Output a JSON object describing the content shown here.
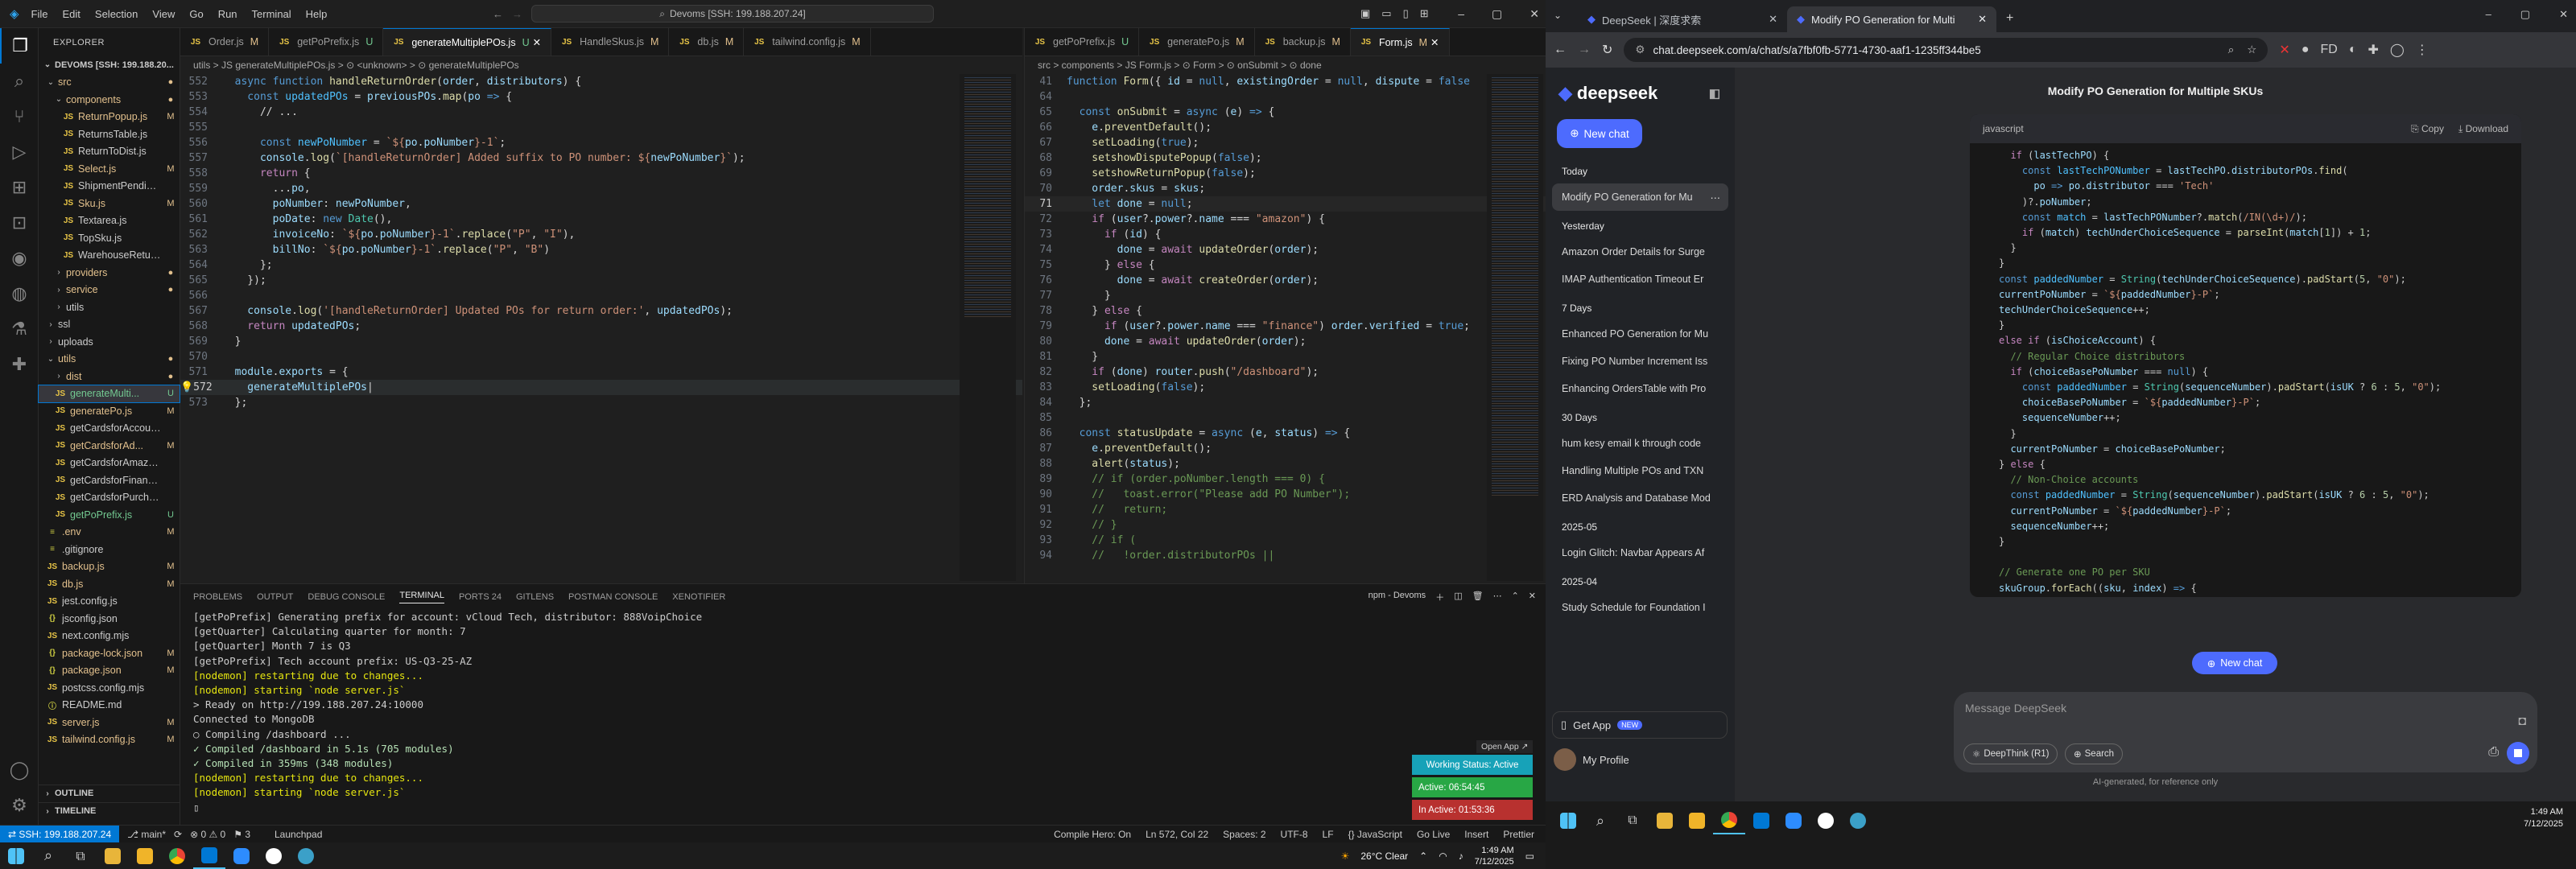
{
  "vscode": {
    "menu": [
      "File",
      "Edit",
      "Selection",
      "View",
      "Go",
      "Run",
      "Terminal",
      "Help"
    ],
    "command_center": "Devoms [SSH: 199.188.207.24]",
    "explorer_title": "EXPLORER",
    "workspace": "DEVOMS [SSH: 199.188.20...",
    "tree": [
      {
        "name": "src",
        "type": "folder",
        "indent": 1,
        "open": true,
        "badge": "",
        "color": "#e2c08d"
      },
      {
        "name": "components",
        "type": "folder",
        "indent": 2,
        "open": true,
        "badge": "",
        "color": "#e2c08d"
      },
      {
        "name": "ReturnPopup.js",
        "type": "js",
        "indent": 3,
        "badge": "M",
        "color": "#e2c08d"
      },
      {
        "name": "ReturnsTable.js",
        "type": "js",
        "indent": 3,
        "badge": "",
        "color": "#cccccc"
      },
      {
        "name": "ReturnToDist.js",
        "type": "js",
        "indent": 3,
        "badge": "",
        "color": "#cccccc"
      },
      {
        "name": "Select.js",
        "type": "js",
        "indent": 3,
        "badge": "M",
        "color": "#e2c08d"
      },
      {
        "name": "ShipmentPending...",
        "type": "js",
        "indent": 3,
        "badge": "",
        "color": "#cccccc"
      },
      {
        "name": "Sku.js",
        "type": "js",
        "indent": 3,
        "badge": "M",
        "color": "#e2c08d"
      },
      {
        "name": "Textarea.js",
        "type": "js",
        "indent": 3,
        "badge": "",
        "color": "#cccccc"
      },
      {
        "name": "TopSku.js",
        "type": "js",
        "indent": 3,
        "badge": "",
        "color": "#cccccc"
      },
      {
        "name": "WarehouseReturn.js",
        "type": "js",
        "indent": 3,
        "badge": "",
        "color": "#cccccc"
      },
      {
        "name": "providers",
        "type": "folder",
        "indent": 2,
        "open": false,
        "badge": "",
        "color": "#e2c08d"
      },
      {
        "name": "service",
        "type": "folder",
        "indent": 2,
        "open": false,
        "badge": "",
        "color": "#e2c08d"
      },
      {
        "name": "utils",
        "type": "folder",
        "indent": 2,
        "open": false,
        "badge": "",
        "color": "#cccccc"
      },
      {
        "name": "ssl",
        "type": "folder",
        "indent": 1,
        "open": false,
        "badge": "",
        "color": "#cccccc"
      },
      {
        "name": "uploads",
        "type": "folder",
        "indent": 1,
        "open": false,
        "badge": "",
        "color": "#cccccc"
      },
      {
        "name": "utils",
        "type": "folder",
        "indent": 1,
        "open": true,
        "badge": "",
        "color": "#e2c08d"
      },
      {
        "name": "dist",
        "type": "folder",
        "indent": 2,
        "open": false,
        "badge": "",
        "color": "#e2c08d"
      },
      {
        "name": "generateMulti...",
        "type": "js",
        "indent": 2,
        "badge": "U",
        "color": "#73c991",
        "selected": true
      },
      {
        "name": "generatePo.js",
        "type": "js",
        "indent": 2,
        "badge": "M",
        "color": "#e2c08d"
      },
      {
        "name": "getCardsforAccount.js",
        "type": "js",
        "indent": 2,
        "badge": "",
        "color": "#cccccc"
      },
      {
        "name": "getCardsforAd...",
        "type": "js",
        "indent": 2,
        "badge": "M",
        "color": "#e2c08d"
      },
      {
        "name": "getCardsforAmazon.js",
        "type": "js",
        "indent": 2,
        "badge": "",
        "color": "#cccccc"
      },
      {
        "name": "getCardsforFinance.js",
        "type": "js",
        "indent": 2,
        "badge": "",
        "color": "#cccccc"
      },
      {
        "name": "getCardsforPurchasi...",
        "type": "js",
        "indent": 2,
        "badge": "",
        "color": "#cccccc"
      },
      {
        "name": "getPoPrefix.js",
        "type": "js",
        "indent": 2,
        "badge": "U",
        "color": "#73c991"
      },
      {
        "name": ".env",
        "type": "cfg",
        "indent": 1,
        "badge": "M",
        "color": "#e2c08d"
      },
      {
        "name": ".gitignore",
        "type": "cfg",
        "indent": 1,
        "badge": "",
        "color": "#cccccc"
      },
      {
        "name": "backup.js",
        "type": "js",
        "indent": 1,
        "badge": "M",
        "color": "#e2c08d"
      },
      {
        "name": "db.js",
        "type": "js",
        "indent": 1,
        "badge": "M",
        "color": "#e2c08d"
      },
      {
        "name": "jest.config.js",
        "type": "js",
        "indent": 1,
        "badge": "",
        "color": "#cccccc"
      },
      {
        "name": "jsconfig.json",
        "type": "json",
        "indent": 1,
        "badge": "",
        "color": "#cccccc"
      },
      {
        "name": "next.config.mjs",
        "type": "js",
        "indent": 1,
        "badge": "",
        "color": "#cccccc"
      },
      {
        "name": "package-lock.json",
        "type": "json",
        "indent": 1,
        "badge": "M",
        "color": "#e2c08d"
      },
      {
        "name": "package.json",
        "type": "json",
        "indent": 1,
        "badge": "M",
        "color": "#e2c08d"
      },
      {
        "name": "postcss.config.mjs",
        "type": "js",
        "indent": 1,
        "badge": "",
        "color": "#cccccc"
      },
      {
        "name": "README.md",
        "type": "md",
        "indent": 1,
        "badge": "",
        "color": "#cccccc"
      },
      {
        "name": "server.js",
        "type": "js",
        "indent": 1,
        "badge": "M",
        "color": "#e2c08d"
      },
      {
        "name": "tailwind.config.js",
        "type": "js",
        "indent": 1,
        "badge": "M",
        "color": "#e2c08d"
      }
    ],
    "outline": "OUTLINE",
    "timeline": "TIMELINE",
    "left_tabs": [
      {
        "label": "Order.js",
        "badge": "M"
      },
      {
        "label": "getPoPrefix.js",
        "badge": "U"
      },
      {
        "label": "generateMultiplePOs.js",
        "badge": "U",
        "active": true
      },
      {
        "label": "HandleSkus.js",
        "badge": "M"
      },
      {
        "label": "db.js",
        "badge": "M"
      },
      {
        "label": "tailwind.config.js",
        "badge": "M"
      }
    ],
    "left_breadcrumb": "utils > JS generateMultiplePOs.js > ⊙ <unknown> > ⊙ generateMultiplePOs",
    "right_tabs": [
      {
        "label": "getPoPrefix.js",
        "badge": "U"
      },
      {
        "label": "generatePo.js",
        "badge": "M"
      },
      {
        "label": "backup.js",
        "badge": "M"
      },
      {
        "label": "Form.js",
        "badge": "M",
        "active": true
      }
    ],
    "right_breadcrumb": "src > components > JS Form.js > ⊙ Form > ⊙ onSubmit > ⊙ done",
    "panel_tabs": [
      "PROBLEMS",
      "OUTPUT",
      "DEBUG CONSOLE",
      "TERMINAL",
      "PORTS 24",
      "GITLENS",
      "POSTMAN CONSOLE",
      "XENOTIFIER"
    ],
    "terminal_label": "npm - Devoms",
    "terminal_lines": [
      "[getPoPrefix] Generating prefix for account: vCloud Tech, distributor: 888VoipChoice",
      "[getQuarter] Calculating quarter for month: 7",
      "[getQuarter] Month 7 is Q3",
      "[getPoPrefix] Tech account prefix: US-Q3-25-AZ",
      "[nodemon] restarting due to changes...",
      "[nodemon] starting `node server.js`",
      "> Ready on http://199.188.207.24:10000",
      "Connected to MongoDB",
      " ○ Compiling /dashboard ...",
      " ✓ Compiled /dashboard in 5.1s (705 modules)",
      " ✓ Compiled in 359ms (348 modules)",
      "[nodemon] restarting due to changes...",
      "[nodemon] starting `node server.js`",
      "▯"
    ],
    "popups": {
      "open_app": "Open App ↗",
      "working": "Working Status: Active",
      "active": "Active: 06:54:45",
      "inactive": "In Active: 01:53:36"
    },
    "status": {
      "remote": "⇄ SSH: 199.188.207.24",
      "branch": "⎇ main*",
      "sync": "⟳",
      "problems": "⊗ 0 ⚠ 0",
      "ports": "⚑ 3",
      "launchpad": "Launchpad",
      "compile": "Compile Hero: On",
      "position": "Ln 572, Col 22",
      "spaces": "Spaces: 2",
      "encoding": "UTF-8",
      "eol": "LF",
      "lang": "{} JavaScript",
      "golive": "Go Live",
      "insert": "Insert",
      "prettier": "Prettier"
    }
  },
  "left_taskbar": {
    "weather": "26°C Clear",
    "time": "1:49 AM",
    "date": "7/12/2025"
  },
  "browser": {
    "tabs": [
      {
        "label": "DeepSeek | 深度求索",
        "active": false
      },
      {
        "label": "Modify PO Generation for Multi",
        "active": true
      }
    ],
    "url": "chat.deepseek.com/a/chat/s/a7fbf0fb-5771-4730-aaf1-1235ff344be5",
    "logo": "deepseek",
    "new_chat": "New chat",
    "sections": [
      {
        "label": "Today",
        "items": [
          "Modify PO Generation for Mu"
        ]
      },
      {
        "label": "Yesterday",
        "items": [
          "Amazon Order Details for Surge",
          "IMAP Authentication Timeout Er"
        ]
      },
      {
        "label": "7 Days",
        "items": [
          "Enhanced PO Generation for Mu",
          "Fixing PO Number Increment Iss",
          "Enhancing OrdersTable with Pro"
        ]
      },
      {
        "label": "30 Days",
        "items": [
          "hum kesy email k through code",
          "Handling Multiple POs and TXN",
          "ERD Analysis and Database Mod"
        ]
      },
      {
        "label": "2025-05",
        "items": [
          "Login Glitch: Navbar Appears Af"
        ]
      },
      {
        "label": "2025-04",
        "items": [
          "Study Schedule for Foundation I"
        ]
      }
    ],
    "get_app": "Get App",
    "new_badge": "NEW",
    "my_profile": "My Profile",
    "chat_title": "Modify PO Generation for Multiple SKUs",
    "code_lang": "javascript",
    "copy": "Copy",
    "download": "Download",
    "new_chat_float": "New chat",
    "input_placeholder": "Message DeepSeek",
    "deepthink": "DeepThink (R1)",
    "search": "Search",
    "disclaimer": "AI-generated, for reference only"
  },
  "right_taskbar": {
    "time": "1:49 AM",
    "date": "7/12/2025"
  },
  "colors": {
    "accent": "#0078d4",
    "deepseek_blue": "#4d6bfe",
    "status_green": "#28a745",
    "status_red": "#b8312f"
  }
}
